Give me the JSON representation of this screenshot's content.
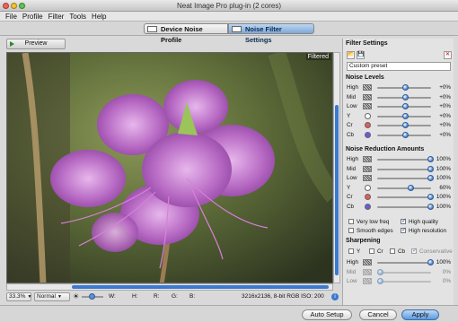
{
  "window": {
    "title": "Neat Image Pro plug-in (2 cores)"
  },
  "menu": [
    "File",
    "Profile",
    "Filter",
    "Tools",
    "Help"
  ],
  "modes": {
    "device": "Device Noise Profile",
    "filter": "Noise Filter Settings"
  },
  "preview": {
    "tab": "Preview",
    "badge": "Filtered"
  },
  "status": {
    "zoom": "33.3%",
    "view_mode": "Normal",
    "w": "W:",
    "h": "H:",
    "r": "R:",
    "g": "G:",
    "b": "B:",
    "info": "3216x2136, 8-bit RGB  ISO: 200"
  },
  "panel": {
    "title": "Filter Settings",
    "preset": "Custom preset",
    "noise_levels": {
      "title": "Noise Levels",
      "rows": [
        {
          "label": "High",
          "value": "+0%",
          "knob": 0.5
        },
        {
          "label": "Mid",
          "value": "+0%",
          "knob": 0.5
        },
        {
          "label": "Low",
          "value": "+0%",
          "knob": 0.5
        },
        {
          "label": "Y",
          "value": "+0%",
          "knob": 0.5,
          "color": "#ffffff"
        },
        {
          "label": "Cr",
          "value": "+0%",
          "knob": 0.5,
          "color": "#e85a55"
        },
        {
          "label": "Cb",
          "value": "+0%",
          "knob": 0.5,
          "color": "#6a5ae0"
        }
      ]
    },
    "noise_reduction": {
      "title": "Noise Reduction Amounts",
      "rows": [
        {
          "label": "High",
          "value": "100%",
          "knob": 1.0
        },
        {
          "label": "Mid",
          "value": "100%",
          "knob": 1.0
        },
        {
          "label": "Low",
          "value": "100%",
          "knob": 1.0
        },
        {
          "label": "Y",
          "value": "60%",
          "knob": 0.6,
          "color": "#ffffff"
        },
        {
          "label": "Cr",
          "value": "100%",
          "knob": 1.0,
          "color": "#e85a55"
        },
        {
          "label": "Cb",
          "value": "100%",
          "knob": 1.0,
          "color": "#6a5ae0"
        }
      ]
    },
    "options": {
      "very_low_freq": "Very low freq",
      "high_quality": "High quality",
      "smooth_edges": "Smooth edges",
      "high_resolution": "High resolution"
    },
    "sharpening": {
      "title": "Sharpening",
      "y": "Y",
      "cr": "Cr",
      "cb": "Cb",
      "conservative": "Conservative",
      "rows": [
        {
          "label": "High",
          "value": "100%",
          "knob": 1.0
        },
        {
          "label": "Mid",
          "value": "0%",
          "knob": 0.0
        },
        {
          "label": "Low",
          "value": "0%",
          "knob": 0.0
        }
      ]
    }
  },
  "footer": {
    "auto_setup": "Auto Setup",
    "cancel": "Cancel",
    "apply": "Apply"
  },
  "colors": {
    "accent": "#3b79d1",
    "flower": "#b86bc4"
  }
}
